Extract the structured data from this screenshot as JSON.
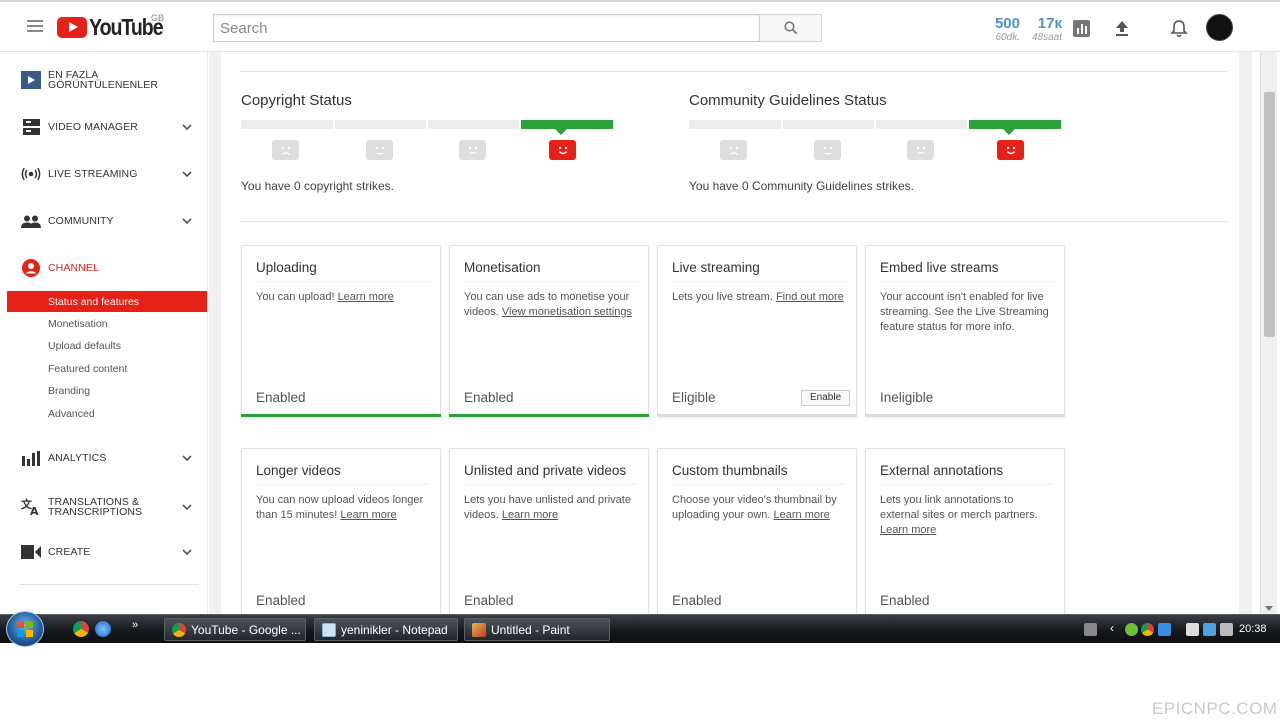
{
  "header": {
    "logo_text": "YouTube",
    "country": "GB",
    "search_placeholder": "Search",
    "stats": [
      {
        "value": "500",
        "label": "60dk."
      },
      {
        "value": "17к",
        "label": "48saat"
      }
    ],
    "icons": [
      "analytics-icon",
      "upload-icon",
      "bell-icon"
    ]
  },
  "sidebar": {
    "top_item": "EN FAZLA GÖRÜNTÜLENENLER",
    "sections": [
      {
        "label": "VIDEO MANAGER",
        "icon": "video-manager-icon"
      },
      {
        "label": "LIVE STREAMING",
        "icon": "live-streaming-icon"
      },
      {
        "label": "COMMUNITY",
        "icon": "community-icon"
      },
      {
        "label": "CHANNEL",
        "icon": "channel-icon"
      },
      {
        "label": "ANALYTICS",
        "icon": "analytics-icon"
      },
      {
        "label": "TRANSLATIONS & TRANSCRIPTIONS",
        "icon": "translate-icon"
      },
      {
        "label": "CREATE",
        "icon": "create-icon"
      }
    ],
    "channel_items": [
      "Status and features",
      "Monetisation",
      "Upload defaults",
      "Featured content",
      "Branding",
      "Advanced"
    ],
    "active_item": "Status and features"
  },
  "main": {
    "copyright": {
      "title": "Copyright Status",
      "text": "You have 0 copyright strikes."
    },
    "community": {
      "title": "Community Guidelines Status",
      "text": "You have 0 Community Guidelines strikes."
    },
    "cards": [
      {
        "title": "Uploading",
        "desc": "You can upload!",
        "link": "Learn more",
        "status": "Enabled",
        "bar": "green"
      },
      {
        "title": "Monetisation",
        "desc": "You can use ads to monetise your videos.",
        "link": "View monetisation settings",
        "status": "Enabled",
        "bar": "green"
      },
      {
        "title": "Live streaming",
        "desc": "Lets you live stream.",
        "link": "Find out more",
        "status": "Eligible",
        "button": "Enable",
        "bar": "grey"
      },
      {
        "title": "Embed live streams",
        "desc": "Your account isn't enabled for live streaming. See the Live Streaming feature status for more info.",
        "link": "",
        "status": "Ineligible",
        "bar": "grey"
      },
      {
        "title": "Longer videos",
        "desc": "You can now upload videos longer than 15 minutes!",
        "link": "Learn more",
        "status": "Enabled",
        "bar": "green"
      },
      {
        "title": "Unlisted and private videos",
        "desc": "Lets you have unlisted and private videos.",
        "link": "Learn more",
        "status": "Enabled",
        "bar": "green"
      },
      {
        "title": "Custom thumbnails",
        "desc": "Choose your video's thumbnail by uploading your own.",
        "link": "Learn more",
        "status": "Enabled",
        "bar": "green"
      },
      {
        "title": "External annotations",
        "desc": "Lets you link annotations to external sites or merch partners.",
        "link": "Learn more",
        "status": "Enabled",
        "bar": "green"
      }
    ]
  },
  "taskbar": {
    "windows": [
      {
        "label": "YouTube - Google ...",
        "color": "#db4437"
      },
      {
        "label": "yeninikler - Notepad",
        "color": "#7fb3e0"
      },
      {
        "label": "Untitled - Paint",
        "color": "#e7b84a"
      }
    ],
    "clock": "20:38"
  },
  "watermark": "EPICNPC.COM",
  "colors": {
    "accent": "#e62117",
    "ok": "#2ba13a",
    "link_blue": "#4e91d1"
  }
}
